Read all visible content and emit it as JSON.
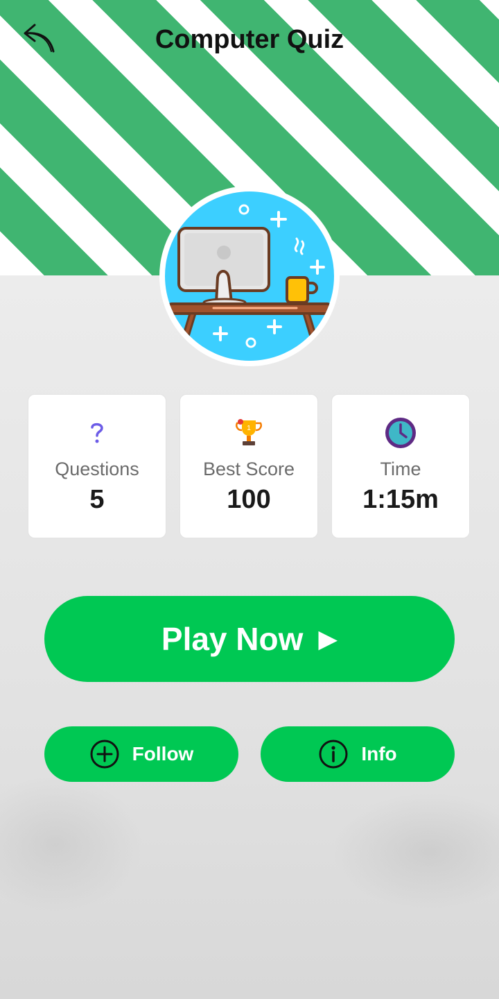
{
  "header": {
    "title": "Computer Quiz",
    "back_icon": "back-arrow-icon"
  },
  "hero": {
    "image": "computer-desk-illustration"
  },
  "stats": [
    {
      "icon": "question-mark-icon",
      "label": "Questions",
      "value": "5"
    },
    {
      "icon": "trophy-icon",
      "label": "Best Score",
      "value": "100"
    },
    {
      "icon": "clock-icon",
      "label": "Time",
      "value": "1:15m"
    }
  ],
  "actions": {
    "play_label": "Play Now",
    "play_icon": "play-arrow-icon",
    "follow_label": "Follow",
    "follow_icon": "plus-circle-icon",
    "info_label": "Info",
    "info_icon": "info-circle-icon"
  },
  "colors": {
    "stripe_green": "#40b571",
    "button_green": "#00c853",
    "hero_blue": "#3ccfff"
  }
}
